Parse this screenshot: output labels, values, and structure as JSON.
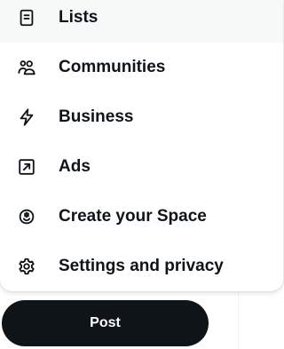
{
  "menu": {
    "items": [
      {
        "label": "Lists",
        "icon": "lists-icon"
      },
      {
        "label": "Communities",
        "icon": "communities-icon"
      },
      {
        "label": "Business",
        "icon": "lightning-icon"
      },
      {
        "label": "Ads",
        "icon": "ads-arrow-icon"
      },
      {
        "label": "Create your Space",
        "icon": "spaces-mic-icon"
      },
      {
        "label": "Settings and privacy",
        "icon": "gear-icon"
      }
    ]
  },
  "post_button": {
    "label": "Post"
  },
  "colors": {
    "text": "#0f1419",
    "hover_background": "#f7f9f9",
    "post_button_background": "#0f1419",
    "post_button_text": "#ffffff",
    "divider": "#eff3f4"
  }
}
